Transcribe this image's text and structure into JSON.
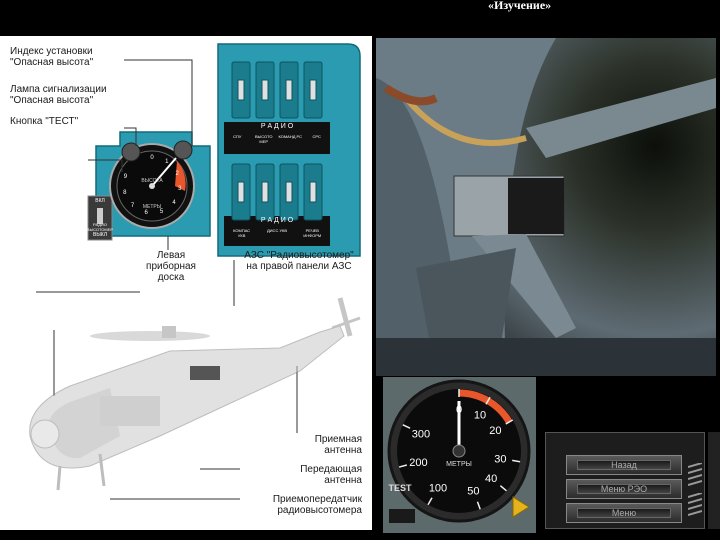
{
  "header": {
    "mode_label": "«Изучение»",
    "line1": "",
    "line2": ""
  },
  "diagram": {
    "callouts": {
      "index": "Индекс установки\n\"Опасная высота\"",
      "lamp": "Лампа сигнализации\n\"Опасная высота\"",
      "test_button": "Кнопка \"ТЕСТ\"",
      "left_panel": "Левая\nприборная\nдоска",
      "azs": "АЗС \"Радиовысотомер\"\nна правой панели АЗС",
      "rx_antenna": "Приемная\nантенна",
      "tx_antenna": "Передающая\nантенна",
      "transceiver": "Приемопередатчик\nрадиовысотомера"
    },
    "panel": {
      "radio1": "Р А Д И О",
      "radio2": "Р А Д И О",
      "row1": [
        "СПУ",
        "ВЫСОТО МЕР",
        "КОМАНД РС",
        "СРС"
      ],
      "row2": [
        "КОМПАС УКВ",
        "ДИСС УКВ",
        "РЕЧЕВ ИНФОРМ"
      ]
    },
    "small_gauge": {
      "ticks": [
        "0",
        "1",
        "2",
        "3",
        "4",
        "5",
        "6",
        "7",
        "8",
        "9"
      ],
      "unit": "МЕТРЫ",
      "brand": "ВЫСОТА",
      "switch_label_top": "ВКЛ",
      "switch_label_bottom": "ВЫКЛ",
      "switch_mid": "РАДИО ВЫСОТОМЕР"
    }
  },
  "gauge": {
    "tick_labels": [
      "0",
      "10",
      "20",
      "30",
      "40",
      "50",
      "100",
      "200",
      "300"
    ],
    "unit": "МЕТРЫ",
    "test_label": "TEST"
  },
  "menu": {
    "items": [
      "Назад",
      "Меню РЭО",
      "Меню"
    ]
  },
  "colors": {
    "panel_teal": "#2a9bb0",
    "warning_orange": "#e8562b",
    "diagram_bg": "#ffffff"
  }
}
